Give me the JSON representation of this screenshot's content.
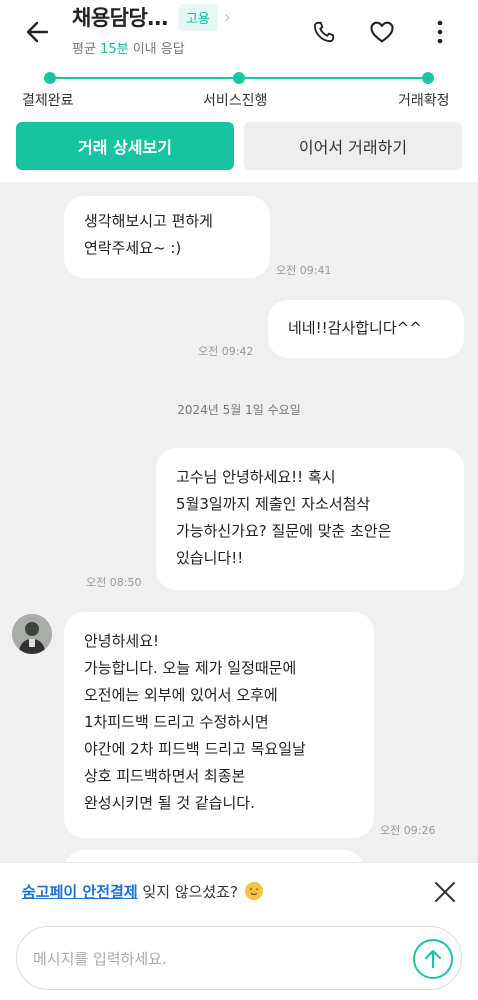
{
  "header": {
    "title": "채용담당…",
    "badge": "고용",
    "subtitle_prefix": "평균 ",
    "subtitle_accent": "15분",
    "subtitle_suffix": " 이내 응답"
  },
  "progress": {
    "steps": [
      "결제완료",
      "서비스진행",
      "거래확정"
    ]
  },
  "actions": {
    "primary": "거래 상세보기",
    "secondary": "이어서 거래하기"
  },
  "messages": [
    {
      "lines": [
        "생각해보시고 편하게",
        "연락주세요~ :)"
      ],
      "time": "오전 09:41",
      "side": "received"
    },
    {
      "lines": [
        "네네!!감사합니다^^"
      ],
      "time": "오전 09:42",
      "side": "sent"
    },
    {
      "date": "2024년 5월 1일 수요일"
    },
    {
      "lines": [
        "고수님 안녕하세요!! 혹시",
        "5월3일까지 제출인 자소서첨삭",
        "가능하신가요? 질문에 맞춘 초안은",
        "있습니다!!"
      ],
      "time": "오전 08:50",
      "side": "sent"
    },
    {
      "lines": [
        "안녕하세요!",
        "가능합니다. 오늘 제가 일정때문에",
        "오전에는 외부에 있어서 오후에",
        "1차피드백 드리고 수정하시면",
        "야간에 2차 피드백 드리고 목요일날",
        "상호 피드백하면서 최종본",
        "완성시키면 될 것 같습니다."
      ],
      "time": "오전 09:26",
      "side": "received"
    }
  ],
  "banner": {
    "link": "숨고페이 안전결제",
    "text": " 잊지 않으셨죠?"
  },
  "input": {
    "placeholder": "메시지를 입력하세요."
  },
  "colors": {
    "accent": "#18c3a1",
    "link": "#1d6fd6",
    "chat_bg": "#f0f0f0"
  }
}
